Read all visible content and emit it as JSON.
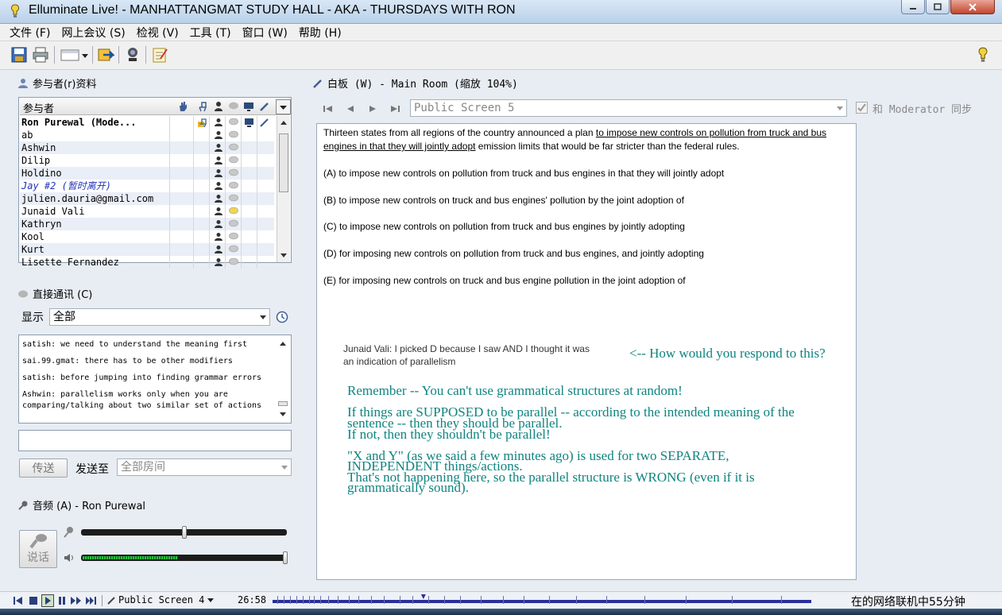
{
  "window": {
    "title": "Elluminate Live! - MANHATTANGMAT STUDY HALL - AKA - THURSDAYS WITH RON"
  },
  "menu": [
    "文件 (F)",
    "网上会议 (S)",
    "检视 (V)",
    "工具 (T)",
    "窗口 (W)",
    "帮助 (H)"
  ],
  "toolbar": {
    "icons": [
      "save-icon",
      "print-icon",
      "layout-icon",
      "transfer-icon",
      "webcam-icon",
      "notes-icon",
      "help-icon"
    ]
  },
  "participants": {
    "title": "参与者(r)资料",
    "column_header": "参与者",
    "rows": [
      {
        "name": "Ron Purewal (Mode...",
        "bold": true,
        "italic": false,
        "color": "#000000",
        "moderator": true
      },
      {
        "name": "ab",
        "bold": false,
        "italic": false,
        "color": "#000000"
      },
      {
        "name": "Ashwin",
        "bold": false,
        "italic": false,
        "color": "#000000"
      },
      {
        "name": "Dilip",
        "bold": false,
        "italic": false,
        "color": "#000000"
      },
      {
        "name": "Holdino",
        "bold": false,
        "italic": false,
        "color": "#000000"
      },
      {
        "name": "Jay #2 (暂时离开)",
        "bold": false,
        "italic": true,
        "color": "#2233bb"
      },
      {
        "name": "julien.dauria@gmail.com",
        "bold": false,
        "italic": false,
        "color": "#000000"
      },
      {
        "name": "Junaid Vali",
        "bold": false,
        "italic": false,
        "color": "#000000",
        "chat_active": true
      },
      {
        "name": "Kathryn",
        "bold": false,
        "italic": false,
        "color": "#000000"
      },
      {
        "name": "Kool",
        "bold": false,
        "italic": false,
        "color": "#000000"
      },
      {
        "name": "Kurt",
        "bold": false,
        "italic": false,
        "color": "#000000"
      },
      {
        "name": "Lisette Fernandez",
        "bold": false,
        "italic": false,
        "color": "#000000"
      }
    ]
  },
  "chat": {
    "title": "直接通讯 (C)",
    "show_label": "显示",
    "show_value": "全部",
    "messages": [
      "satish: we need to understand the meaning first",
      "sai.99.gmat: there has to be other modifiers",
      "satish: before jumping into finding grammar errors",
      "Ashwin: parallelism works only when you are",
      "comparing/talking about two similar set of actions"
    ],
    "input_value": "",
    "send_label": "传送",
    "send_to_label": "发送至",
    "send_to_value": "全部房间"
  },
  "audio": {
    "title": "音频 (A) - Ron Purewal",
    "talk_label": "说话",
    "mic_level": 0.5,
    "speaker_level": 1.0
  },
  "whiteboard": {
    "title": "白板 (W) - Main Room (缩放 104%)",
    "screen_select": "Public Screen 5",
    "sync_label": "和 Moderator 同步",
    "sync_checked": true,
    "question_plain_1": "Thirteen states from all regions of the country announced a plan ",
    "question_underlined_1": "to impose new controls on pollution from truck and bus",
    "question_underlined_2": "engines in that they will jointly adopt",
    "question_plain_2": " emission limits that would be far stricter than the federal rules.",
    "options": [
      "(A) to impose new controls on pollution from truck and bus engines in that they will jointly adopt",
      "(B) to impose new controls on truck and bus engines' pollution by the joint adoption of",
      "(C) to impose new controls on pollution from truck and bus engines by jointly adopting",
      "(D) for imposing new controls on pollution from truck and bus engines, and jointly adopting",
      "(E) for imposing new controls on truck and bus engine pollution in the joint adoption of"
    ],
    "student_note_1": "Junaid Vali: I picked D because I saw AND I thought it was",
    "student_note_2": "an indication of parallelism",
    "respond_prompt": "<-- How would you respond to this?",
    "teacher_lines": [
      "Remember -- You can't use grammatical structures at random!",
      "If things are SUPPOSED to be parallel -- according to the intended meaning of the",
      "sentence -- then they should be parallel.",
      "If not, then they shouldn't be parallel!",
      "\"X and Y\" (as we said a few minutes ago) is used for two SEPARATE,",
      "INDEPENDENT things/actions.",
      "That's not happening here, so the parallel structure is WRONG (even if it is",
      "grammatically sound)."
    ]
  },
  "status": {
    "screen_label": "Public Screen 4",
    "time": "26:58",
    "online_text": "在的网络联机中55分钟",
    "playback_progress": 0.28
  },
  "colors": {
    "teal": "#0e8480",
    "timeline": "#2a2f9a"
  }
}
